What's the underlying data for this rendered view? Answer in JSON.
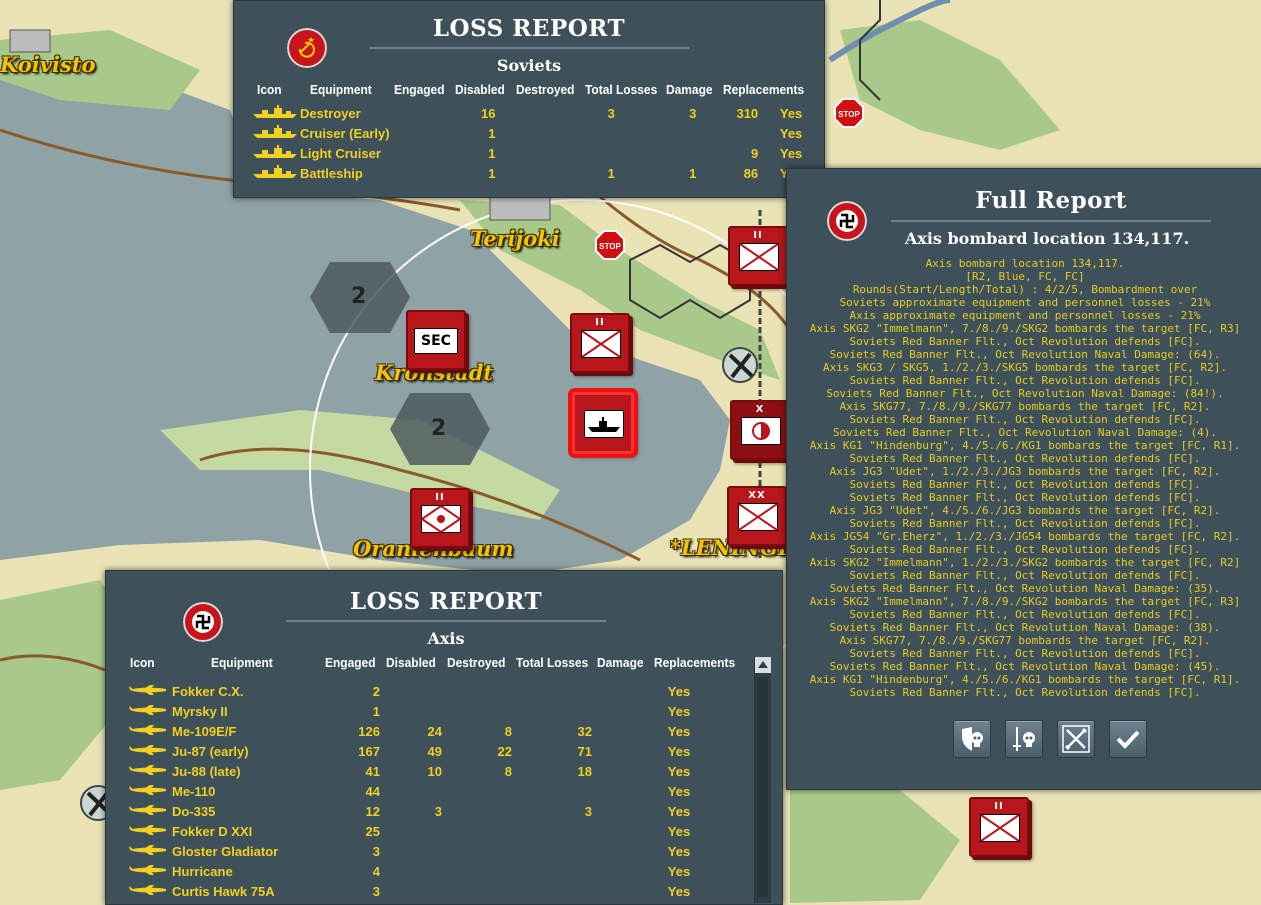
{
  "map": {
    "places": [
      {
        "id": "koivisto",
        "label": "Koivisto"
      },
      {
        "id": "terijoki",
        "label": "Terijoki"
      },
      {
        "id": "kronstadt",
        "label": "Kronstadt"
      },
      {
        "id": "oranienbaum",
        "label": "Oranienbaum"
      },
      {
        "id": "leningrad",
        "label": "*LENINGRAD"
      }
    ],
    "stop_label": "STOP",
    "hex_counts": [
      "2",
      "2"
    ],
    "unit_sec_label": "SEC",
    "unit_size_ii": "II",
    "unit_size_x": "X",
    "unit_size_xx": "XX"
  },
  "soviet_report": {
    "title": "LOSS REPORT",
    "side": "Soviets",
    "columns": [
      "Icon",
      "Equipment",
      "Engaged",
      "Disabled",
      "Destroyed",
      "Total Losses",
      "Damage",
      "Replacements"
    ],
    "rows": [
      {
        "equipment": "Destroyer",
        "engaged": "16",
        "disabled": "",
        "destroyed": "3",
        "total": "3",
        "damage": "310",
        "repl": "Yes"
      },
      {
        "equipment": "Cruiser (Early)",
        "engaged": "1",
        "disabled": "",
        "destroyed": "",
        "total": "",
        "damage": "",
        "repl": "Yes"
      },
      {
        "equipment": "Light Cruiser",
        "engaged": "1",
        "disabled": "",
        "destroyed": "",
        "total": "",
        "damage": "9",
        "repl": "Yes"
      },
      {
        "equipment": "Battleship",
        "engaged": "1",
        "disabled": "",
        "destroyed": "1",
        "total": "1",
        "damage": "86",
        "repl": "Yes"
      }
    ]
  },
  "axis_report": {
    "title": "LOSS REPORT",
    "side": "Axis",
    "columns": [
      "Icon",
      "Equipment",
      "Engaged",
      "Disabled",
      "Destroyed",
      "Total Losses",
      "Damage",
      "Replacements"
    ],
    "rows": [
      {
        "equipment": "Fokker C.X.",
        "engaged": "2",
        "disabled": "",
        "destroyed": "",
        "total": "",
        "damage": "",
        "repl": "Yes"
      },
      {
        "equipment": "Myrsky II",
        "engaged": "1",
        "disabled": "",
        "destroyed": "",
        "total": "",
        "damage": "",
        "repl": "Yes"
      },
      {
        "equipment": "Me-109E/F",
        "engaged": "126",
        "disabled": "24",
        "destroyed": "8",
        "total": "32",
        "damage": "",
        "repl": "Yes"
      },
      {
        "equipment": "Ju-87 (early)",
        "engaged": "167",
        "disabled": "49",
        "destroyed": "22",
        "total": "71",
        "damage": "",
        "repl": "Yes"
      },
      {
        "equipment": "Ju-88 (late)",
        "engaged": "41",
        "disabled": "10",
        "destroyed": "8",
        "total": "18",
        "damage": "",
        "repl": "Yes"
      },
      {
        "equipment": "Me-110",
        "engaged": "44",
        "disabled": "",
        "destroyed": "",
        "total": "",
        "damage": "",
        "repl": "Yes"
      },
      {
        "equipment": "Do-335",
        "engaged": "12",
        "disabled": "3",
        "destroyed": "",
        "total": "3",
        "damage": "",
        "repl": "Yes"
      },
      {
        "equipment": "Fokker D XXI",
        "engaged": "25",
        "disabled": "",
        "destroyed": "",
        "total": "",
        "damage": "",
        "repl": "Yes"
      },
      {
        "equipment": "Gloster Gladiator",
        "engaged": "3",
        "disabled": "",
        "destroyed": "",
        "total": "",
        "damage": "",
        "repl": "Yes"
      },
      {
        "equipment": "Hurricane",
        "engaged": "4",
        "disabled": "",
        "destroyed": "",
        "total": "",
        "damage": "",
        "repl": "Yes"
      },
      {
        "equipment": "Curtis Hawk 75A",
        "engaged": "3",
        "disabled": "",
        "destroyed": "",
        "total": "",
        "damage": "",
        "repl": "Yes"
      }
    ]
  },
  "full_report": {
    "title": "Full Report",
    "subtitle": "Axis bombard location 134,117.",
    "lines": [
      "Axis bombard location 134,117.",
      "[R2, Blue, FC, FC]",
      "Rounds(Start/Length/Total) : 4/2/5, Bombardment over",
      "Soviets approximate equipment and personnel losses - 21%",
      "Axis approximate equipment and personnel losses - 21%",
      "Axis SKG2 \"Immelmann\", 7./8./9./SKG2 bombards the target [FC, R3]",
      "Soviets Red Banner Flt., Oct Revolution defends [FC].",
      "Soviets Red Banner Flt., Oct Revolution Naval Damage: (64).",
      "Axis SKG3 / SKG5, 1./2./3./SKG5 bombards the target [FC, R2].",
      "Soviets Red Banner Flt., Oct Revolution defends [FC].",
      "Soviets Red Banner Flt., Oct Revolution Naval Damage: (84!).",
      "Axis SKG77, 7./8./9./SKG77 bombards the target [FC, R2].",
      "Soviets Red Banner Flt., Oct Revolution defends [FC].",
      "Soviets Red Banner Flt., Oct Revolution Naval Damage: (4).",
      "Axis KG1 \"Hindenburg\", 4./5./6./KG1 bombards the target [FC, R1].",
      "Soviets Red Banner Flt., Oct Revolution defends [FC].",
      "Axis JG3 \"Udet\", 1./2./3./JG3 bombards the target [FC, R2].",
      "Soviets Red Banner Flt., Oct Revolution defends [FC].",
      "Soviets Red Banner Flt., Oct Revolution defends [FC].",
      "Axis JG3 \"Udet\", 4./5./6./JG3 bombards the target [FC, R2].",
      "Soviets Red Banner Flt., Oct Revolution defends [FC].",
      "Axis JG54 \"Gr.Eherz\", 1./2./3./JG54 bombards the target [FC, R2].",
      "Soviets Red Banner Flt., Oct Revolution defends [FC].",
      "Axis SKG2 \"Immelmann\", 1./2./3./SKG2 bombards the target [FC, R2]",
      "Soviets Red Banner Flt., Oct Revolution defends [FC].",
      "Soviets Red Banner Flt., Oct Revolution Naval Damage: (35).",
      "Axis SKG2 \"Immelmann\", 7./8./9./SKG2 bombards the target [FC, R3]",
      "Soviets Red Banner Flt., Oct Revolution defends [FC].",
      "Soviets Red Banner Flt., Oct Revolution Naval Damage: (38).",
      "Axis SKG77, 7./8./9./SKG77 bombards the target [FC, R2].",
      "Soviets Red Banner Flt., Oct Revolution defends [FC].",
      "Soviets Red Banner Flt., Oct Revolution Naval Damage: (45).",
      "Axis KG1 \"Hindenburg\", 4./5./6./KG1 bombards the target [FC, R1].",
      "Soviets Red Banner Flt., Oct Revolution defends [FC]."
    ],
    "buttons": [
      {
        "id": "shield-skull",
        "icon": "shield-skull-icon"
      },
      {
        "id": "sword-skull",
        "icon": "sword-skull-icon"
      },
      {
        "id": "swords-crossed",
        "icon": "crossed-swords-icon"
      },
      {
        "id": "confirm",
        "icon": "checkmark-icon"
      }
    ]
  },
  "colors": {
    "panel": "#3e505a",
    "text_yellow": "#f0d020",
    "unit_red": "#b8161b",
    "water": "#8fa3a6",
    "land": "#e9e3b6",
    "forest": "#a9c98a"
  }
}
